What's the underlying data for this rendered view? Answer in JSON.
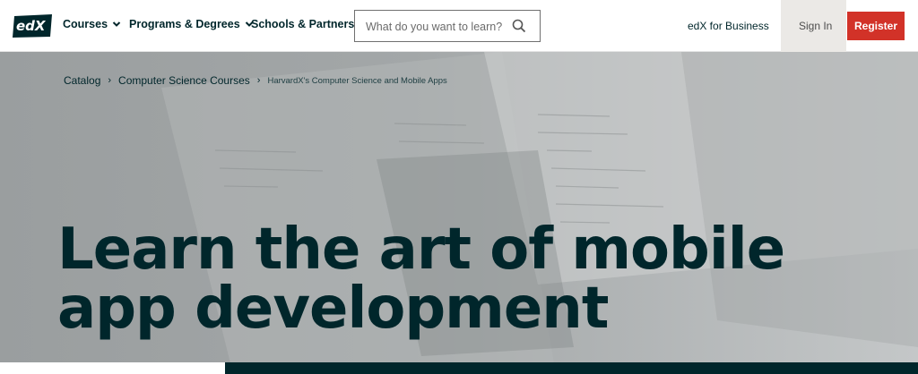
{
  "header": {
    "logo_text": "edX",
    "nav": [
      {
        "label": "Courses",
        "has_dropdown": true
      },
      {
        "label": "Programs & Degrees",
        "has_dropdown": true
      },
      {
        "label": "Schools & Partners",
        "has_dropdown": false
      }
    ],
    "search": {
      "placeholder": "What do you want to learn?",
      "value": "",
      "icon": "search-icon"
    },
    "business_link": "edX for Business",
    "sign_in": "Sign In",
    "register": "Register"
  },
  "breadcrumb": {
    "items": [
      "Catalog",
      "Computer Science Courses"
    ],
    "separator": "›",
    "current": "HarvardX's Computer Science and Mobile Apps"
  },
  "hero": {
    "title_line1": "Learn the art of mobile",
    "title_line2": "app development"
  },
  "colors": {
    "brand_dark": "#00262b",
    "register_red": "#d23228",
    "signin_bg": "#ebe9e6",
    "hero_bg": "#9fa3a4"
  }
}
